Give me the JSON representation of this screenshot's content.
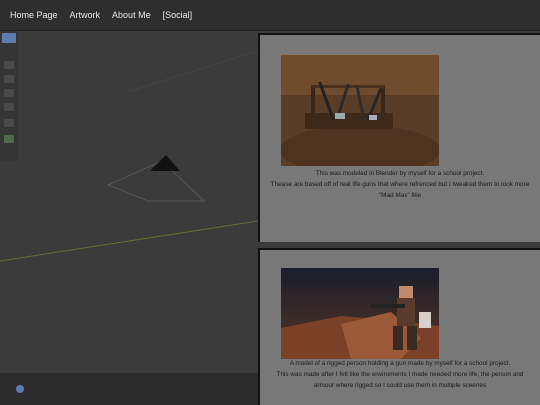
{
  "nav": {
    "items": [
      "Home Page",
      "Artwork",
      "About Me",
      "[Social]"
    ]
  },
  "panels": [
    {
      "image_alt": "Low-poly model of a wooden rack holding guns",
      "caption_lines": [
        "This was modeled in Blender by myself for a school project.",
        "Thease are based off of real life guns that where refrenced but I tweaked them to look more",
        "\"Mad Max\" like"
      ]
    },
    {
      "image_alt": "Low-poly rigged person holding a gun on a rock",
      "caption_lines": [
        "A model of a rigged person holding a gun made by myself for a school project.",
        "This was made after I felt like the enviroments I made needed more life, the person and",
        "armour where rigged so I could use them in multiple sceenes"
      ]
    }
  ],
  "colors": {
    "nav_bg": "#2e2e2e",
    "panel_bg": "#787878",
    "viewport_bg": "#3b3b3b",
    "accent": "#5e7dad"
  }
}
